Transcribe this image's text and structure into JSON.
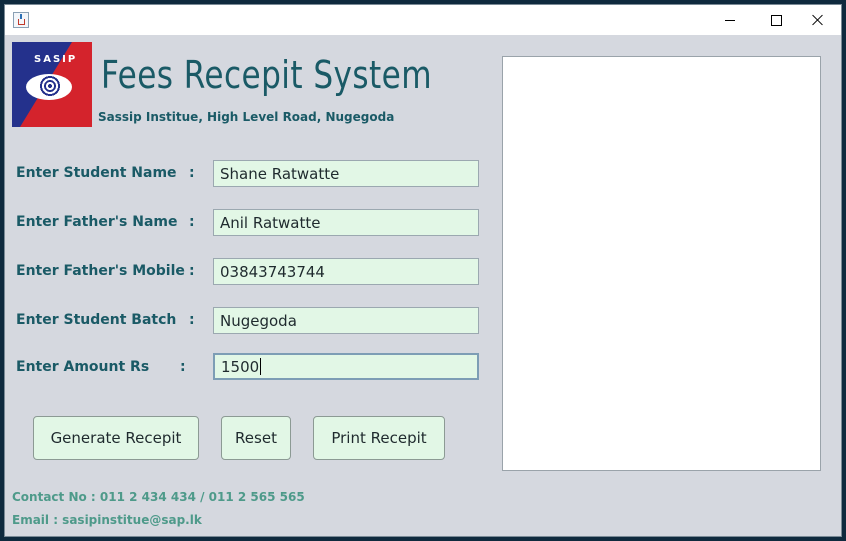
{
  "window": {
    "title": ""
  },
  "header": {
    "logo_text": "SASIP",
    "title": "Fees Recepit System",
    "subtitle": "Sassip Institue, High Level Road, Nugegoda"
  },
  "form": {
    "colon": ":",
    "fields": [
      {
        "label": "Enter Student Name",
        "value": "Shane Ratwatte"
      },
      {
        "label": "Enter Father's Name",
        "value": "Anil Ratwatte"
      },
      {
        "label": "Enter Father's Mobile",
        "value": "03843743744"
      },
      {
        "label": "Enter Student Batch",
        "value": "Nugegoda"
      },
      {
        "label": "Enter Amount Rs",
        "value": "1500"
      }
    ]
  },
  "buttons": {
    "generate": "Generate Recepit",
    "reset": "Reset",
    "print": "Print Recepit"
  },
  "footer": {
    "contact": "Contact No : 011 2 434 434 / 011 2 565 565",
    "email": "Email : sasipinstitue@sap.lk"
  }
}
